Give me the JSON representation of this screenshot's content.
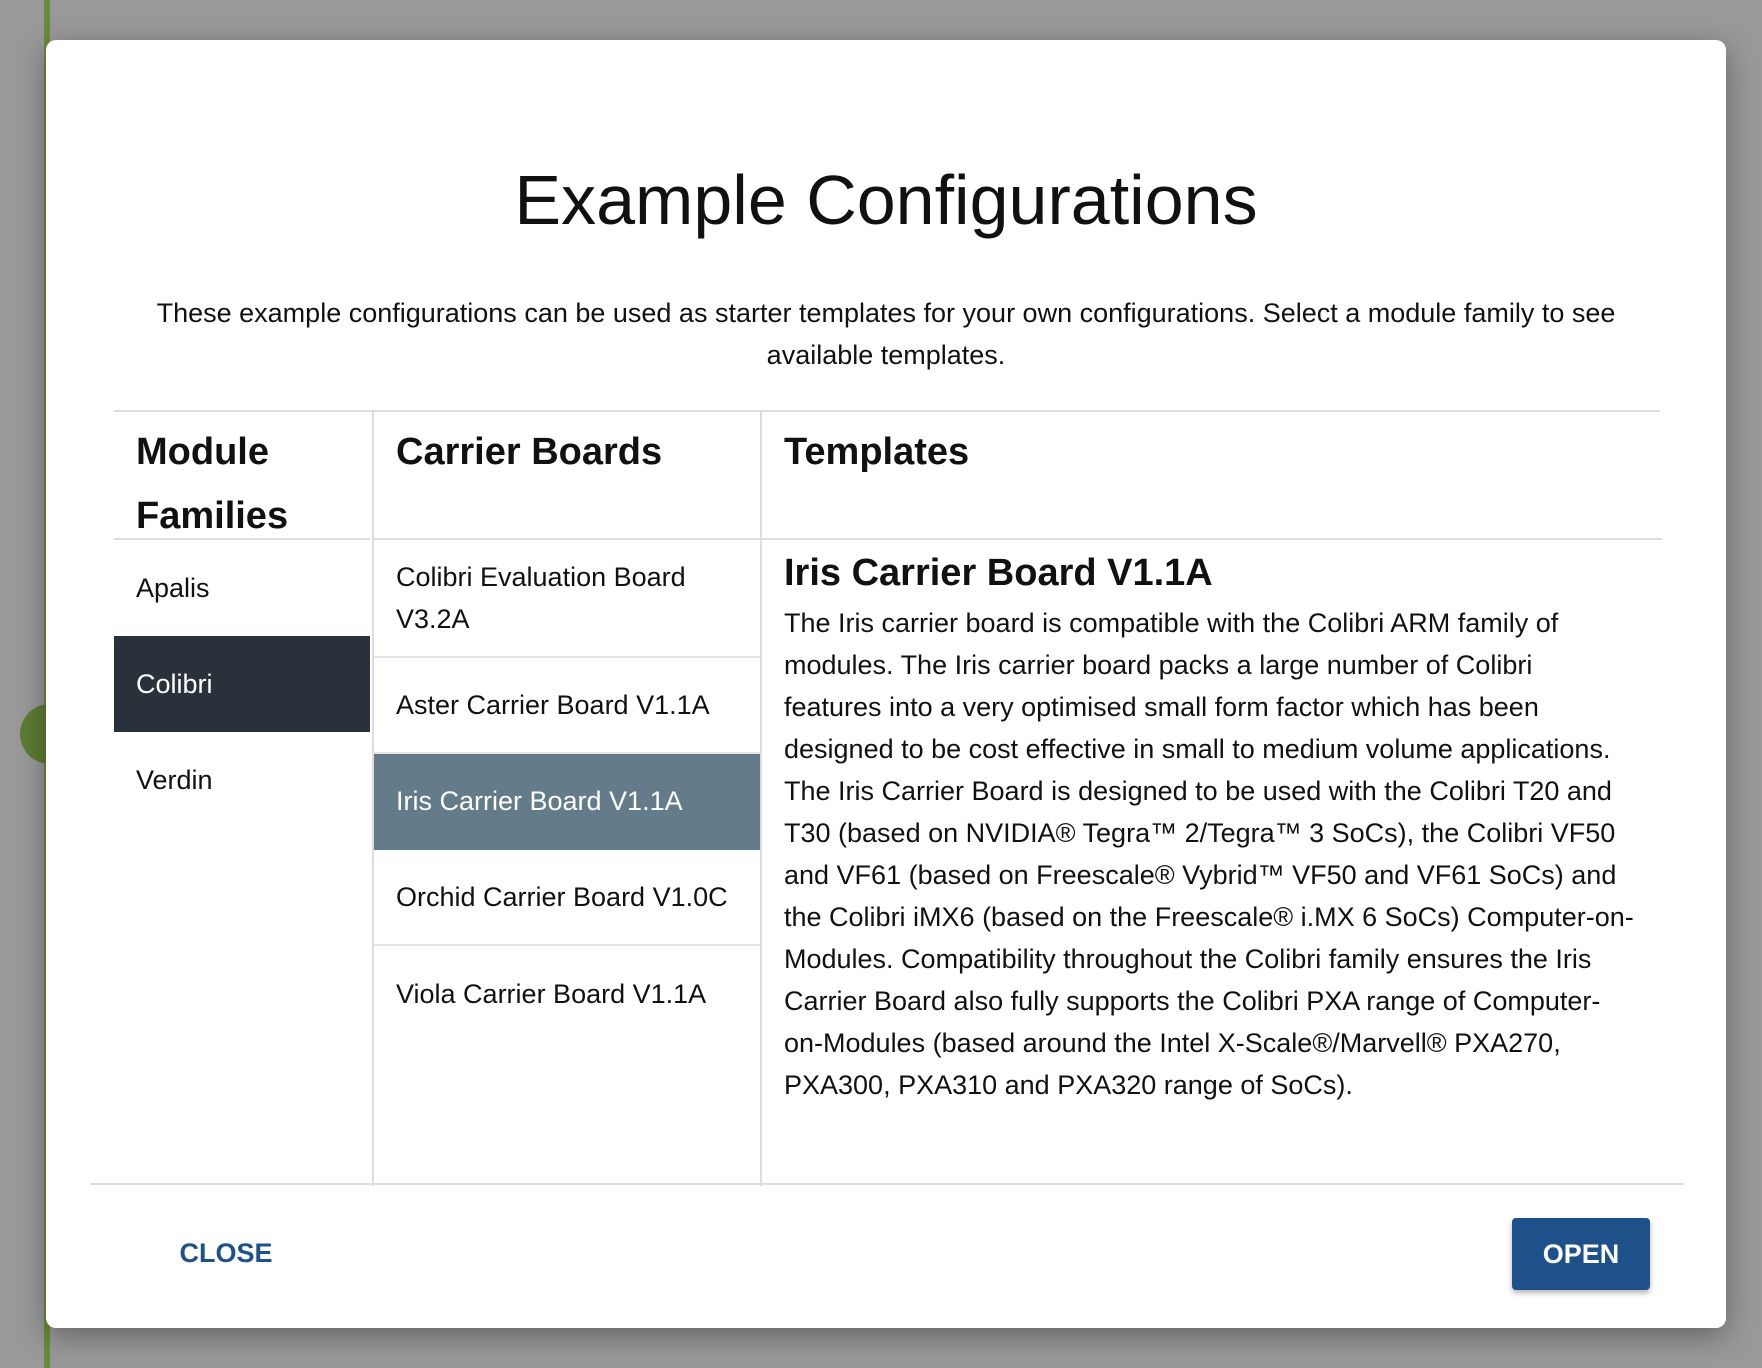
{
  "dialog": {
    "title": "Example Configurations",
    "description": "These example configurations can be used as starter templates for your own configurations. Select a module family to see available templates."
  },
  "columns": {
    "module_families": "Module Families",
    "carrier_boards": "Carrier Boards",
    "templates": "Templates"
  },
  "module_families": [
    {
      "label": "Apalis",
      "selected": false
    },
    {
      "label": "Colibri",
      "selected": true
    },
    {
      "label": "Verdin",
      "selected": false
    }
  ],
  "carrier_boards": [
    {
      "label": "Colibri Evaluation Board V3.2A",
      "selected": false
    },
    {
      "label": "Aster Carrier Board V1.1A",
      "selected": false
    },
    {
      "label": "Iris Carrier Board V1.1A",
      "selected": true
    },
    {
      "label": "Orchid Carrier Board V1.0C",
      "selected": false
    },
    {
      "label": "Viola Carrier Board V1.1A",
      "selected": false
    }
  ],
  "template": {
    "title": "Iris Carrier Board V1.1A",
    "description": "The Iris carrier board is compatible with the Colibri ARM family of modules. The Iris carrier board packs a large number of Colibri features into a very optimised small form factor which has been designed to be cost effective in small to medium volume applications. The Iris Carrier Board is designed to be used with the Colibri T20 and T30 (based on NVIDIA® Tegra™ 2/Tegra™ 3 SoCs), the Colibri VF50 and VF61 (based on Freescale® Vybrid™ VF50 and VF61 SoCs) and the Colibri iMX6 (based on the Freescale® i.MX 6 SoCs) Computer-on-Modules. Compatibility throughout the Colibri family ensures the Iris Carrier Board also fully supports the Colibri PXA range of Computer-on-Modules (based around the Intel X-Scale®/Marvell® PXA270, PXA300, PXA310 and PXA320 range of SoCs)."
  },
  "buttons": {
    "close": "CLOSE",
    "open": "OPEN"
  },
  "colors": {
    "primary": "#1e5189",
    "module_selected_bg": "#29323a",
    "carrier_selected_bg": "#647c8a",
    "backdrop": "#999999"
  }
}
